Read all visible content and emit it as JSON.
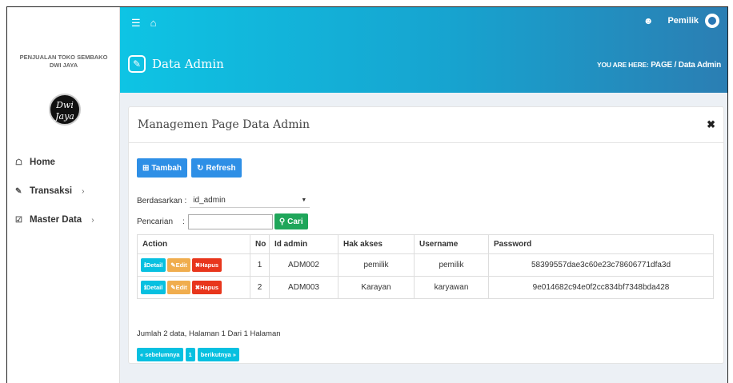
{
  "sidebar": {
    "brand_line1": "PENJUALAN TOKO SEMBAKO",
    "brand_line2": "DWI JAYA",
    "logo_text1": "Dwi",
    "logo_text2": "Jaya",
    "items": [
      {
        "label": "Home",
        "icon": "home-icon"
      },
      {
        "label": "Transaksi",
        "icon": "pencil-icon"
      },
      {
        "label": "Master Data",
        "icon": "edit-icon"
      }
    ]
  },
  "topbar": {
    "user": "Pemilik"
  },
  "header": {
    "title": "Data Admin",
    "crumb_prefix": "YOU ARE HERE:",
    "crumb_page": "PAGE",
    "crumb_sep": "/",
    "crumb_current": "Data Admin"
  },
  "panel": {
    "title": "Managemen Page Data Admin",
    "btn_add": "Tambah",
    "btn_refresh": "Refresh",
    "filter_label": "Berdasarkan :",
    "filter_value": "id_admin",
    "search_label": "Pencarian",
    "search_colon": ":",
    "btn_search": "Cari",
    "columns": [
      "Action",
      "No",
      "Id admin",
      "Hak akses",
      "Username",
      "Password"
    ],
    "action_labels": {
      "detail": "Detail",
      "edit": "Edit",
      "delete": "Hapus"
    },
    "rows": [
      {
        "no": "1",
        "id": "ADM002",
        "hak": "pemilik",
        "user": "pemilik",
        "pass": "58399557dae3c60e23c78606771dfa3d"
      },
      {
        "no": "2",
        "id": "ADM003",
        "hak": "Karayan",
        "user": "karyawan",
        "pass": "9e014682c94e0f2cc834bf7348bda428"
      }
    ],
    "summary": "Jumlah 2 data, Halaman 1 Dari 1 Halaman",
    "pager_prev": "« sebelumnya",
    "pager_page": "1",
    "pager_next": "berikutnya »"
  },
  "colors": {
    "topbar_start": "#0ec4e4",
    "topbar_end": "#2b7eb3",
    "btn_blue": "#2e8fe6",
    "btn_green": "#1fa65a",
    "btn_cyan": "#08c0e0",
    "btn_orange": "#f0ad4e",
    "btn_red": "#e8361c"
  }
}
